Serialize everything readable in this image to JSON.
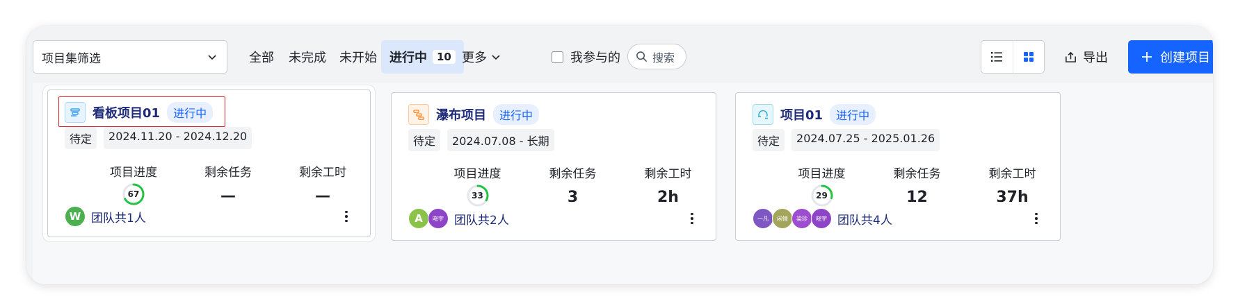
{
  "toolbar": {
    "filter_placeholder": "项目集筛选",
    "tabs": [
      {
        "label": "全部"
      },
      {
        "label": "未完成"
      },
      {
        "label": "未开始"
      },
      {
        "label": "进行中",
        "count": "10"
      },
      {
        "label": "更多"
      }
    ],
    "my_participation": "我参与的",
    "search_label": "搜索",
    "export_label": "导出",
    "create_label": "创建项目"
  },
  "colors": {
    "accent": "#1664ff",
    "title": "#1d2b79",
    "progress": "#23c343"
  },
  "cards": [
    {
      "title": "看板项目01",
      "status": "进行中",
      "icon": "kanban-icon",
      "priority": "待定",
      "date_range": "2024.11.20 - 2024.12.20",
      "progress_label": "项目进度",
      "progress": 67,
      "progress_text": "67",
      "tasks_label": "剩余任务",
      "tasks_value": "—",
      "hours_label": "剩余工时",
      "hours_value": "—",
      "members": [
        {
          "text": "W",
          "color": "#4caf50"
        }
      ],
      "team_text": "团队共1人"
    },
    {
      "title": "瀑布项目",
      "status": "进行中",
      "icon": "waterfall-icon",
      "priority": "待定",
      "date_range": "2024.07.08 - 长期",
      "progress_label": "项目进度",
      "progress": 33,
      "progress_text": "33",
      "tasks_label": "剩余任务",
      "tasks_value": "3",
      "hours_label": "剩余工时",
      "hours_value": "2h",
      "members": [
        {
          "text": "A",
          "color": "#8bc34a"
        },
        {
          "text": "晓宇",
          "color": "#8e44c7"
        }
      ],
      "team_text": "团队共2人"
    },
    {
      "title": "项目01",
      "status": "进行中",
      "icon": "iteration-icon",
      "priority": "待定",
      "date_range": "2024.07.25 - 2025.01.26",
      "progress_label": "项目进度",
      "progress": 29,
      "progress_text": "29",
      "tasks_label": "剩余任务",
      "tasks_value": "12",
      "hours_label": "剩余工时",
      "hours_value": "37h",
      "members": [
        {
          "text": "一凡",
          "color": "#7e57c2"
        },
        {
          "text": "闲情",
          "color": "#a3a55a"
        },
        {
          "text": "梁珍",
          "color": "#9c4dd0"
        },
        {
          "text": "晓宇",
          "color": "#8e44c7"
        }
      ],
      "team_text": "团队共4人"
    }
  ]
}
